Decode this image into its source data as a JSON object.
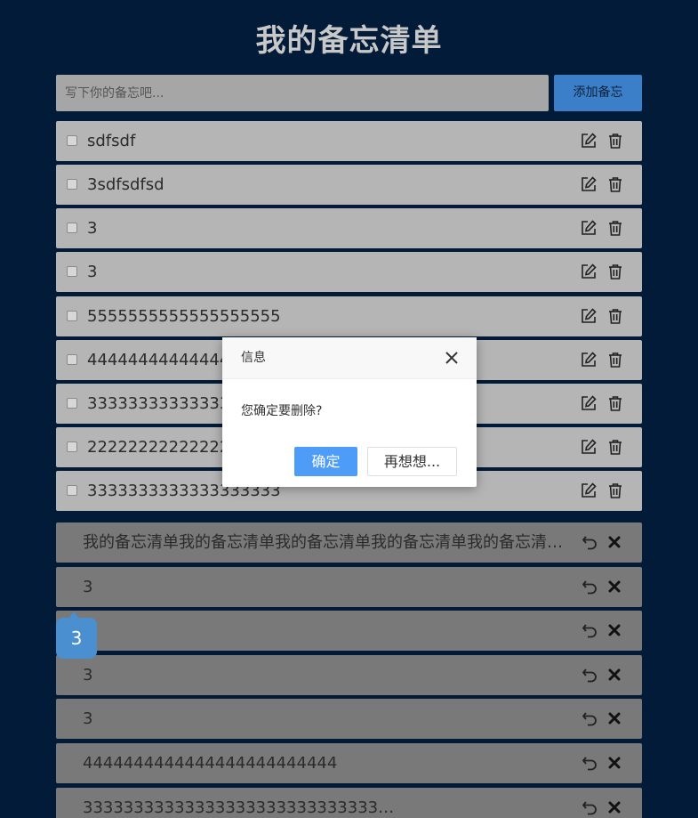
{
  "app": {
    "title": "我的备忘清单"
  },
  "add": {
    "placeholder": "写下你的备忘吧...",
    "button_label": "添加备忘"
  },
  "todos": [
    {
      "text": "sdfsdf",
      "checked": false
    },
    {
      "text": "3sdfsdfsd",
      "checked": false
    },
    {
      "text": "3",
      "checked": false
    },
    {
      "text": "3",
      "checked": false
    },
    {
      "text": "5555555555555555555",
      "checked": false
    },
    {
      "text": "44444444444444",
      "checked": false
    },
    {
      "text": "33333333333333",
      "checked": false
    },
    {
      "text": "22222222222222",
      "checked": false
    },
    {
      "text": "3333333333333333333",
      "checked": false
    }
  ],
  "done": [
    {
      "text": "我的备忘清单我的备忘清单我的备忘清单我的备忘清单我的备忘清单…"
    },
    {
      "text": "3"
    },
    {
      "text": "3"
    },
    {
      "text": "3"
    },
    {
      "text": "3"
    },
    {
      "text": "4444444444444444444444444"
    },
    {
      "text": "33333333333333333333333333333…"
    }
  ],
  "badge": {
    "count": "3"
  },
  "dialog": {
    "title": "信息",
    "message": "您确定要删除?",
    "ok_label": "确定",
    "cancel_label": "再想想..."
  },
  "colors": {
    "background": "#021b38",
    "accent": "#3b7fc8",
    "ok_button": "#4d9cf8",
    "todo_item": "#b5b5b5",
    "done_item": "#797979"
  },
  "icons": {
    "edit": "edit-icon",
    "trash": "trash-icon",
    "undo": "undo-icon",
    "delete": "x-icon",
    "close": "close-icon"
  }
}
